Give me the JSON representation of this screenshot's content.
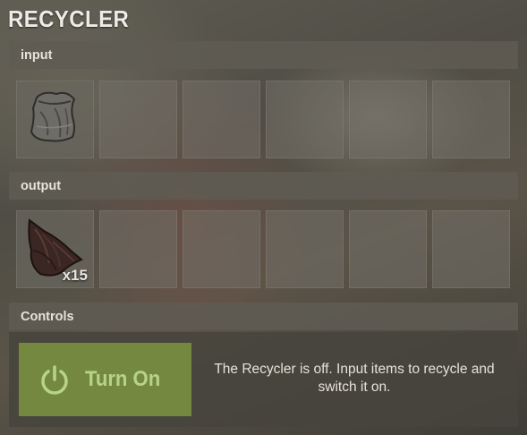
{
  "window": {
    "title": "RECYCLER"
  },
  "input": {
    "header": "input",
    "slots": [
      {
        "item_icon": "cloth-bag-icon",
        "quantity": ""
      },
      {
        "item_icon": "",
        "quantity": ""
      },
      {
        "item_icon": "",
        "quantity": ""
      },
      {
        "item_icon": "",
        "quantity": ""
      },
      {
        "item_icon": "",
        "quantity": ""
      },
      {
        "item_icon": "",
        "quantity": ""
      }
    ]
  },
  "output": {
    "header": "output",
    "slots": [
      {
        "item_icon": "cloth-scrap-icon",
        "quantity": "x15"
      },
      {
        "item_icon": "",
        "quantity": ""
      },
      {
        "item_icon": "",
        "quantity": ""
      },
      {
        "item_icon": "",
        "quantity": ""
      },
      {
        "item_icon": "",
        "quantity": ""
      },
      {
        "item_icon": "",
        "quantity": ""
      }
    ]
  },
  "controls": {
    "header": "Controls",
    "power_button_label": "Turn On",
    "power_icon": "power-icon",
    "status_text": "The Recycler is off. Input items to recycle and switch it on.",
    "colors": {
      "button_bg": "#74893f",
      "button_text": "#b7d38a"
    }
  }
}
